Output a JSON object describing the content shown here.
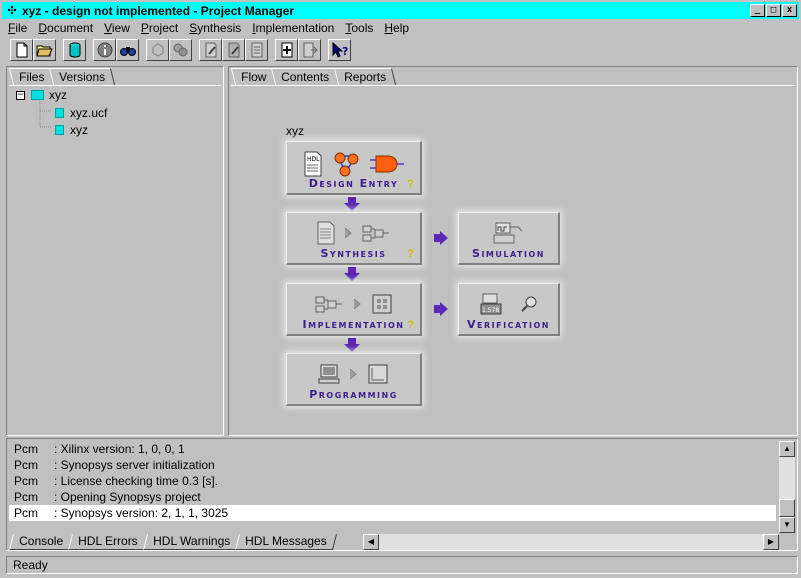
{
  "window": {
    "title": "xyz - design not implemented - Project Manager",
    "minimize": "_",
    "maximize": "□",
    "close": "x"
  },
  "menu": [
    {
      "label": "File",
      "accel": "F",
      "rest": "ile"
    },
    {
      "label": "Document",
      "accel": "D",
      "rest": "ocument"
    },
    {
      "label": "View",
      "accel": "V",
      "rest": "iew"
    },
    {
      "label": "Project",
      "accel": "P",
      "rest": "roject"
    },
    {
      "label": "Synthesis",
      "accel": "S",
      "rest": "ynthesis"
    },
    {
      "label": "Implementation",
      "accel": "I",
      "rest": "mplementation"
    },
    {
      "label": "Tools",
      "accel": "T",
      "rest": "ools"
    },
    {
      "label": "Help",
      "accel": "H",
      "rest": "elp"
    }
  ],
  "left_tabs": [
    "Files",
    "Versions"
  ],
  "tree": {
    "root": "xyz",
    "toggle": "−",
    "children": [
      "xyz.ucf",
      "xyz"
    ]
  },
  "right_tabs": [
    "Flow",
    "Contents",
    "Reports"
  ],
  "flow": {
    "project_name": "xyz",
    "help_mark": "?",
    "design_entry": "Design Entry",
    "synthesis": "Synthesis",
    "simulation": "Simulation",
    "implementation": "Implementation",
    "verification": "Verification",
    "programming": "Programming",
    "hdl_icon_text": "HDL",
    "timing_icon_text": "1.578"
  },
  "console": {
    "lines": [
      {
        "src": "Pcm",
        "msg": ": Xilinx version: 1, 0, 0, 1"
      },
      {
        "src": "Pcm",
        "msg": ": Synopsys server initialization"
      },
      {
        "src": "Pcm",
        "msg": ": License checking time 0.3 [s]."
      },
      {
        "src": "Pcm",
        "msg": ": Opening Synopsys project"
      },
      {
        "src": "Pcm",
        "msg": ": Synopsys version: 2, 1, 1, 3025"
      }
    ],
    "tabs": [
      "Console",
      "HDL Errors",
      "HDL Warnings",
      "HDL Messages"
    ]
  },
  "status": "Ready",
  "colors": {
    "titlebar": "#00ffff",
    "flow_label": "#3c1e8c",
    "flow_arrow": "#5a28b4",
    "file_icon": "#00e0e0"
  }
}
